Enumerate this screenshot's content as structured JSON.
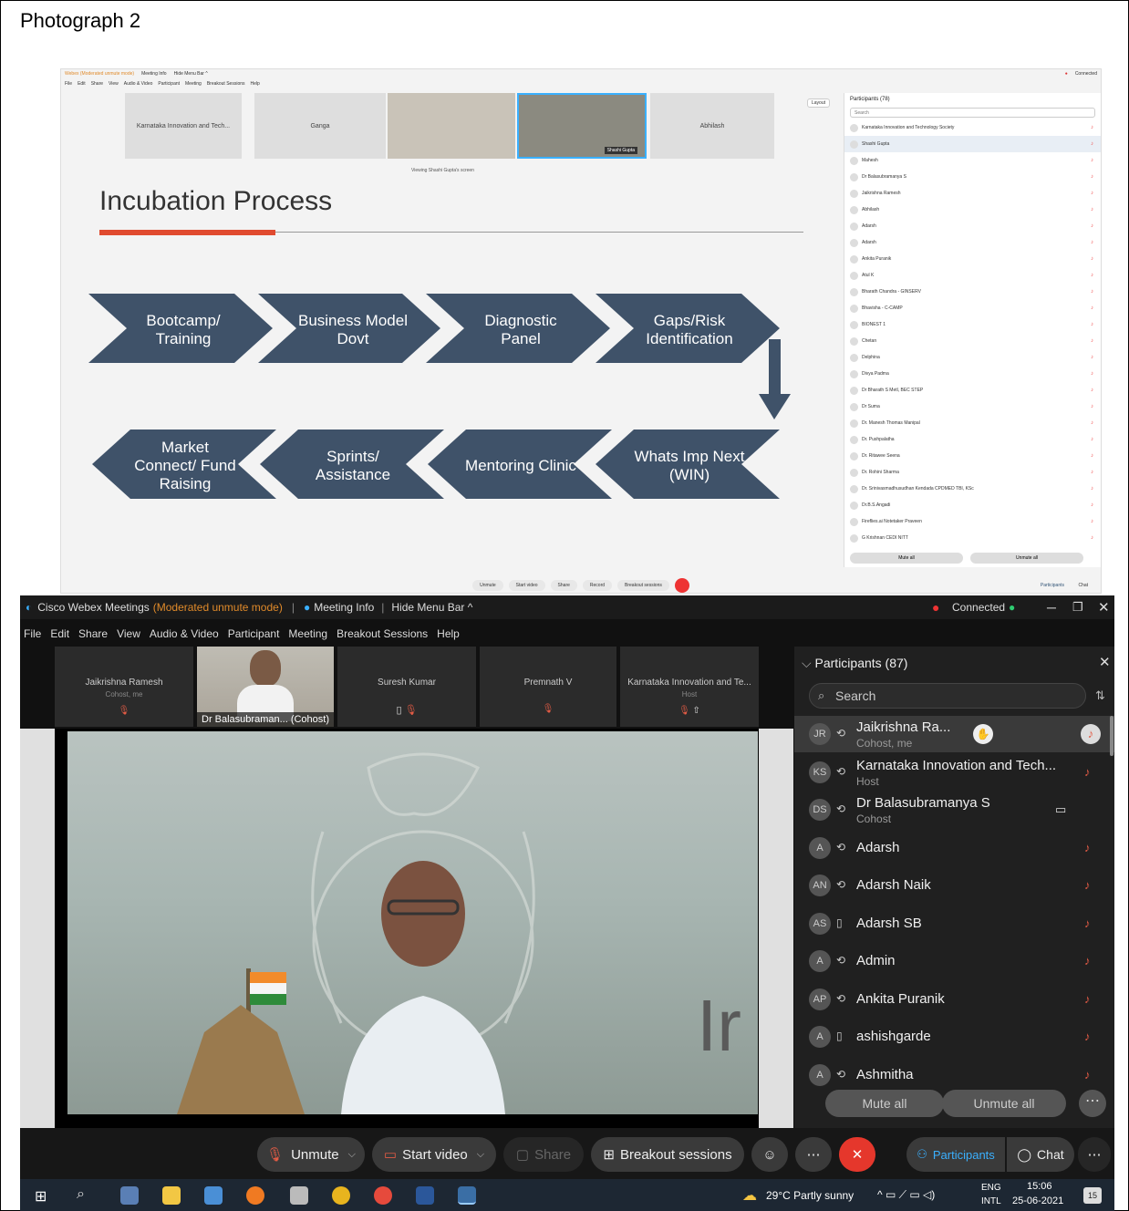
{
  "caption": "Photograph 2",
  "top": {
    "window_title": "Webex (Moderated unmute mode)",
    "meeting_info": "Meeting Info",
    "hide_menu": "Hide Menu Bar ^",
    "menu": [
      "File",
      "Edit",
      "Share",
      "View",
      "Audio & Video",
      "Participant",
      "Meeting",
      "Breakout Sessions",
      "Help"
    ],
    "tiles": [
      "Karnataka Innovation and Tech...",
      "Ganga",
      "",
      "Shashi Gupta",
      "Abhilash"
    ],
    "viewing_label": "Viewing Shashi Gupta's screen",
    "layout_btn": "Layout",
    "slide": {
      "title": "Incubation Process",
      "steps_row1": [
        "Bootcamp/ Training",
        "Business Model Dovt",
        "Diagnostic Panel",
        "Gaps/Risk Identification"
      ],
      "steps_row2": [
        "Market Connect/ Fund Raising",
        "Sprints/ Assistance",
        "Mentoring Clinic",
        "Whats Imp Next (WIN)"
      ]
    },
    "panel_title": "Participants (78)",
    "search_placeholder": "Search",
    "participants": [
      "Karnataka Innovation and Technology Society",
      "Shashi Gupta",
      "Mahesh",
      "Dr Balasubramanya S",
      "Jaikrishna Ramesh",
      "Abhilash",
      "Adarsh",
      "Adarsh",
      "Ankita Puranik",
      "Atul K",
      "Bharath Chandra - GINSERV",
      "Bhavisha - C-CAMP",
      "BIONEST 1",
      "Chetan",
      "Delphina",
      "Divya Padma",
      "Dr Bharath S Metl, BEC STEP",
      "Dr Suma",
      "Dr. Manesh Thomas Manipal",
      "Dr. Pushpalatha",
      "Dr. Ritawee Seena",
      "Dr. Rohini Sharma",
      "Dr. Srinivasmadhusudhan Kendada CPDMED TBI, KSc",
      "Dr.B.S.Angadi",
      "Fireflies.ai Notetaker Praveen",
      "G Krishnan CEDI NITT"
    ],
    "mute_all": "Mute all",
    "unmute_all": "Unmute all",
    "bottom_buttons": [
      "Unmute",
      "Start video",
      "Share",
      "Record",
      "Breakout sessions"
    ],
    "participants_btn": "Participants",
    "chat_btn": "Chat",
    "connected": "Connected"
  },
  "bottom": {
    "app_name": "Cisco Webex Meetings",
    "mode": "(Moderated unmute mode)",
    "meeting_info": "Meeting Info",
    "hide_menu": "Hide Menu Bar ^",
    "connected": "Connected",
    "menu": [
      "File",
      "Edit",
      "Share",
      "View",
      "Audio & Video",
      "Participant",
      "Meeting",
      "Breakout Sessions",
      "Help"
    ],
    "tiles": [
      {
        "name": "Jaikrishna Ramesh",
        "sub": "Cohost, me"
      },
      {
        "name": "Dr Balasubraman... (Cohost)",
        "sub": ""
      },
      {
        "name": "Suresh Kumar",
        "sub": ""
      },
      {
        "name": "Premnath V",
        "sub": ""
      },
      {
        "name": "Karnataka Innovation and Te...",
        "sub": "Host"
      }
    ],
    "panel_title": "Participants (87)",
    "search_placeholder": "Search",
    "participants": [
      {
        "initials": "JR",
        "name": "Jaikrishna Ra...",
        "sub": "Cohost, me"
      },
      {
        "initials": "KS",
        "name": "Karnataka Innovation and Tech...",
        "sub": "Host"
      },
      {
        "initials": "DS",
        "name": "Dr Balasubramanya S",
        "sub": "Cohost"
      },
      {
        "initials": "A",
        "name": "Adarsh",
        "sub": ""
      },
      {
        "initials": "AN",
        "name": "Adarsh Naik",
        "sub": ""
      },
      {
        "initials": "AS",
        "name": "Adarsh SB",
        "sub": ""
      },
      {
        "initials": "A",
        "name": "Admin",
        "sub": ""
      },
      {
        "initials": "AP",
        "name": "Ankita Puranik",
        "sub": ""
      },
      {
        "initials": "A",
        "name": "ashishgarde",
        "sub": ""
      },
      {
        "initials": "A",
        "name": "Ashmitha",
        "sub": ""
      }
    ],
    "mute_all": "Mute all",
    "unmute_all": "Unmute all",
    "controls": {
      "unmute": "Unmute",
      "start_video": "Start video",
      "share": "Share",
      "breakout": "Breakout sessions",
      "participants": "Participants",
      "chat": "Chat"
    },
    "taskbar": {
      "weather": "29°C  Partly sunny",
      "lang1": "ENG",
      "lang2": "INTL",
      "time": "15:06",
      "date": "25-06-2021",
      "notif": "15"
    }
  }
}
